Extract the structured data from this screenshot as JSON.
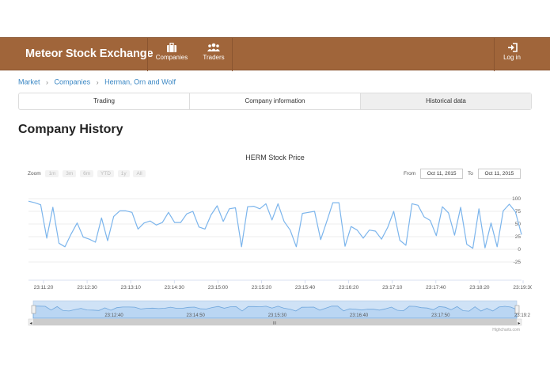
{
  "navbar": {
    "brand": "Meteor Stock Exchange",
    "companies_label": "Companies",
    "traders_label": "Traders",
    "login_label": "Log in",
    "color": "#a0653a"
  },
  "breadcrumb": [
    "Market",
    "Companies",
    "Herman, Orn and Wolf"
  ],
  "tabs": [
    {
      "label": "Trading",
      "active": false
    },
    {
      "label": "Company information",
      "active": false
    },
    {
      "label": "Historical data",
      "active": true
    }
  ],
  "page_title": "Company History",
  "chart": {
    "zoom_label": "Zoom",
    "zoom_buttons": [
      "1m",
      "3m",
      "6m",
      "YTD",
      "1y",
      "All"
    ],
    "from_label": "From",
    "from_value": "Oct 11, 2015",
    "to_label": "To",
    "to_value": "Oct 11, 2015",
    "credits": "Highcharts.com",
    "scrollbar_grip": "III"
  },
  "chart_data": {
    "type": "line",
    "title": "HERM Stock Price",
    "series": [
      {
        "values": [
          95,
          92,
          88,
          22,
          83,
          12,
          5,
          30,
          52,
          24,
          20,
          14,
          62,
          17,
          65,
          76,
          76,
          73,
          40,
          52,
          56,
          48,
          53,
          73,
          53,
          53,
          70,
          75,
          44,
          40,
          68,
          86,
          55,
          80,
          82,
          5,
          84,
          85,
          80,
          90,
          58,
          90,
          55,
          38,
          5,
          71,
          73,
          75,
          19,
          55,
          92,
          92,
          6,
          45,
          38,
          22,
          38,
          36,
          20,
          43,
          75,
          18,
          8,
          90,
          87,
          64,
          57,
          27,
          84,
          72,
          28,
          83,
          10,
          2,
          80,
          3,
          52,
          5,
          76,
          89,
          74,
          29
        ]
      }
    ],
    "ylim": [
      -25,
      100
    ],
    "yticks": [
      "100",
      "75",
      "50",
      "25",
      "0",
      "-25"
    ],
    "xticks": [
      "23:11:20",
      "23:12:30",
      "23:13:10",
      "23:14:30",
      "23:15:00",
      "23:15:20",
      "23:15:40",
      "23:16:20",
      "23:17:10",
      "23:17:40",
      "23:18:20",
      "23:19:30"
    ],
    "navigator_ticks": [
      "23:12:40",
      "23:14:50",
      "23:15:30",
      "23:16:40",
      "23:17:50",
      "23:19:2"
    ],
    "line_color": "#7cb5ec",
    "grid": true
  }
}
